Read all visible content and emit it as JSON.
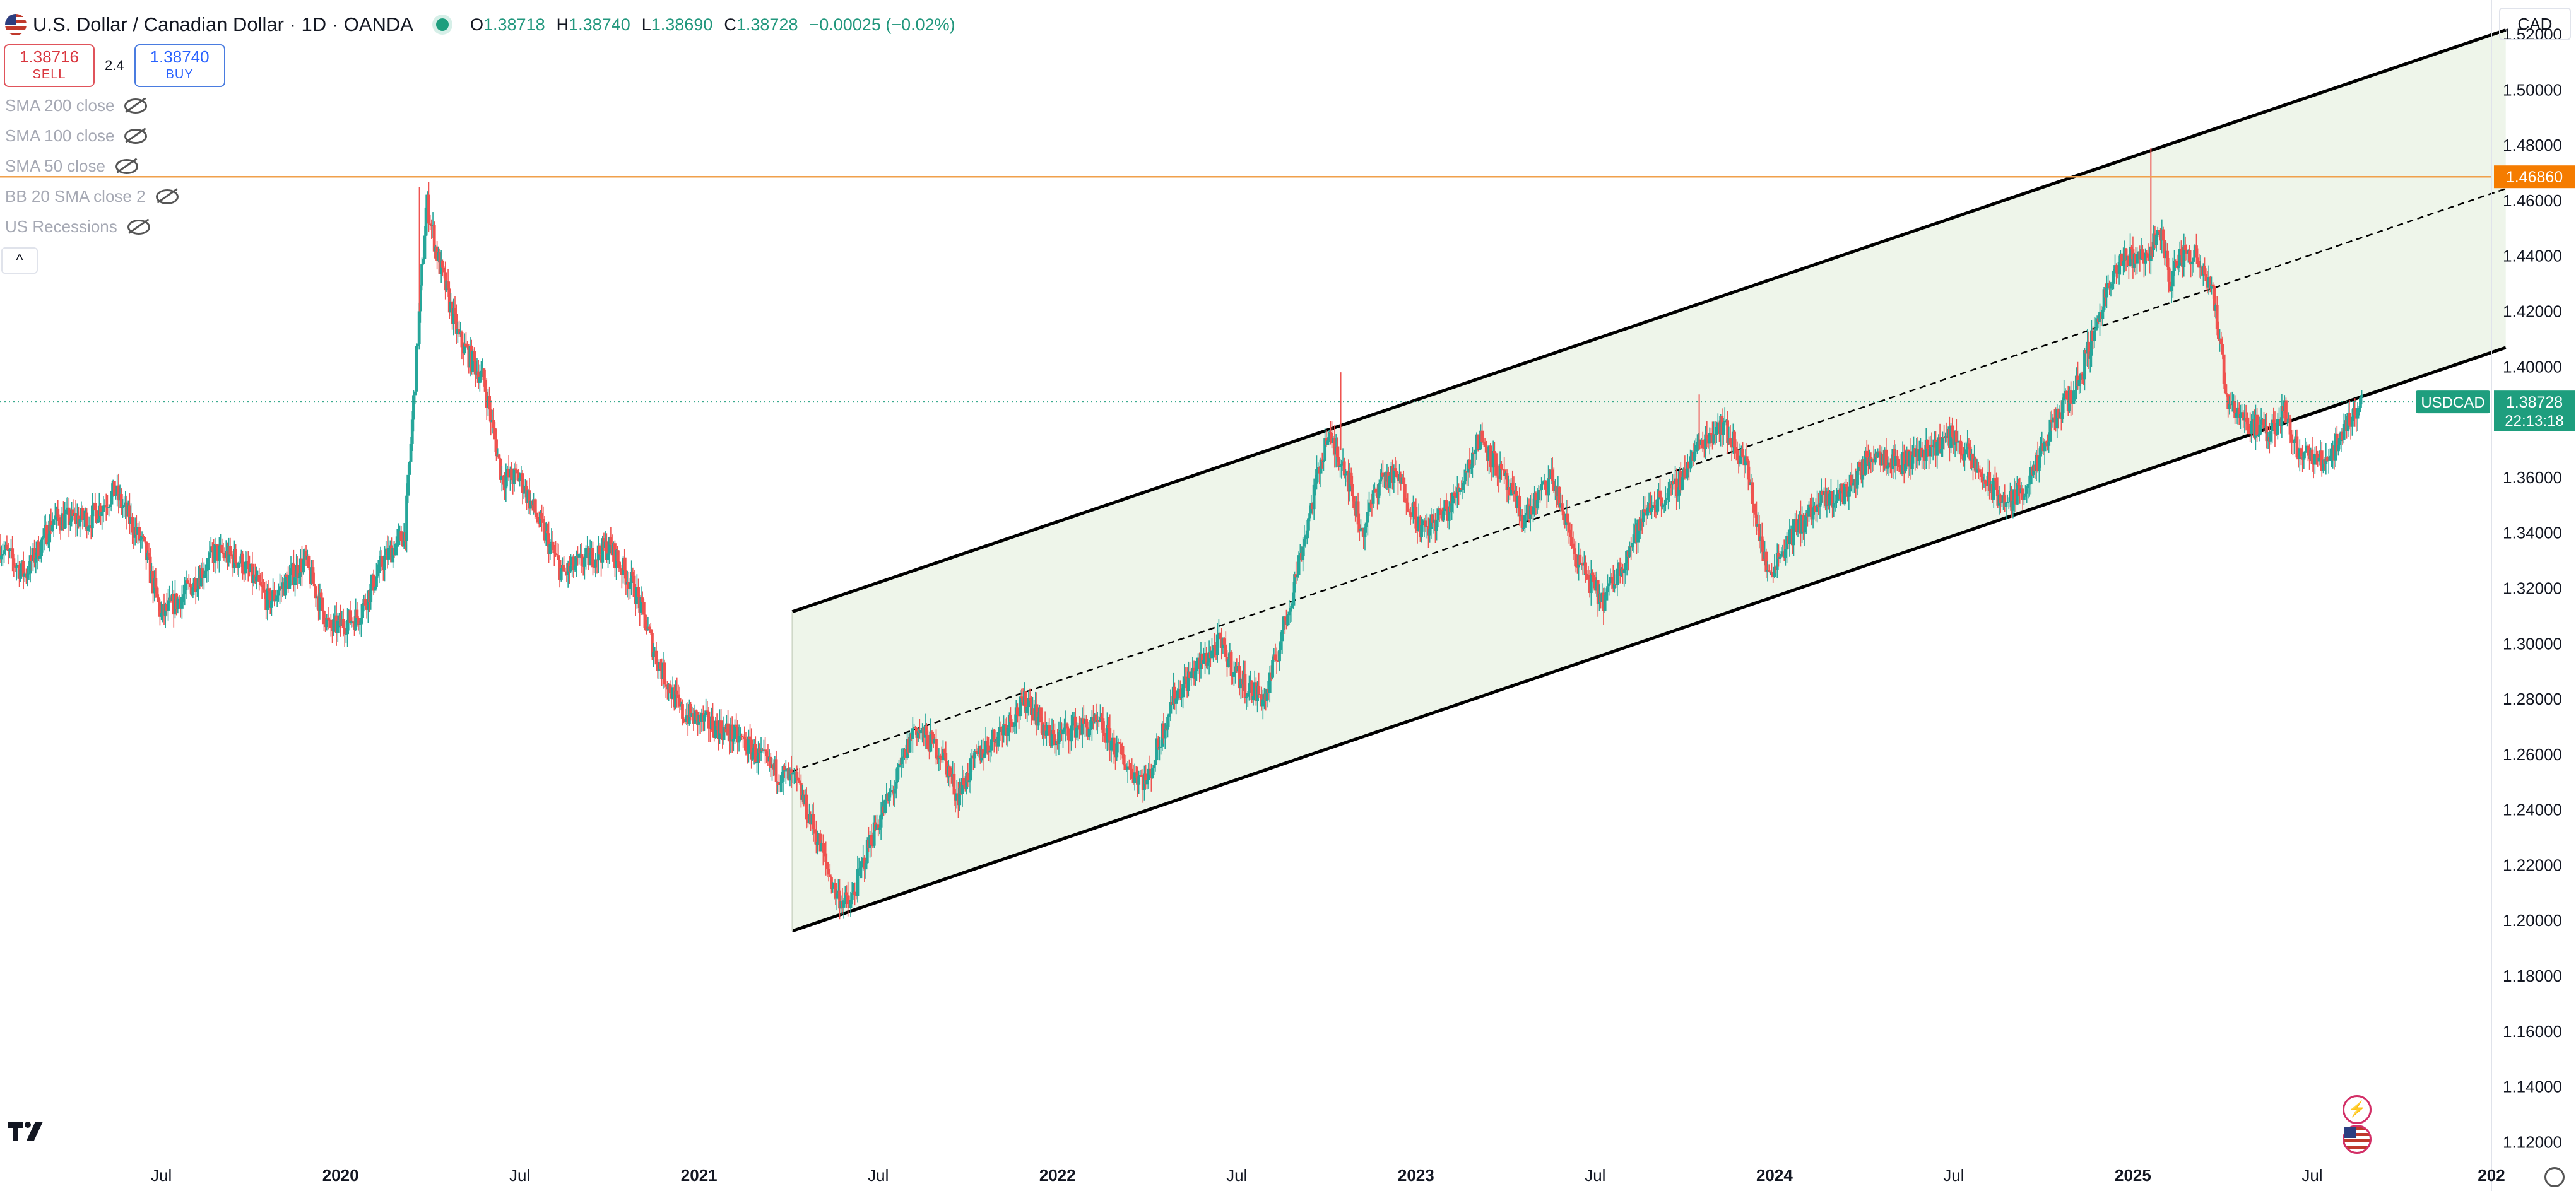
{
  "header": {
    "title": "U.S. Dollar / Canadian Dollar · 1D · OANDA",
    "o_label": "O",
    "o_value": "1.38718",
    "h_label": "H",
    "h_value": "1.38740",
    "l_label": "L",
    "l_value": "1.38690",
    "c_label": "C",
    "c_value": "1.38728",
    "change": "−0.00025 (−0.02%)"
  },
  "trade": {
    "sell_price": "1.38716",
    "sell_label": "SELL",
    "spread": "2.4",
    "buy_price": "1.38740",
    "buy_label": "BUY"
  },
  "indicators": [
    {
      "label": "SMA 200 close",
      "icon": "eye-off-icon"
    },
    {
      "label": "SMA 100 close",
      "icon": "eye-off-icon"
    },
    {
      "label": "SMA 50 close",
      "icon": "eye-off-icon"
    },
    {
      "label": "BB 20 SMA close 2",
      "icon": "eye-off-icon"
    },
    {
      "label": "US Recessions",
      "icon": "eye-off-icon"
    }
  ],
  "collapse_label": "^",
  "currency": "CAD",
  "colors": {
    "up": "#26a69a",
    "down": "#ef5350",
    "channel_fill": "#eef5ea",
    "hline": "#f0a04b",
    "price_tag": "#1e9e7e",
    "level_tag": "#f57c00"
  },
  "chart_data": {
    "type": "candlestick",
    "symbol": "USDCAD",
    "title": "U.S. Dollar / Canadian Dollar · 1D · OANDA",
    "y_ticks": [
      "1.12000",
      "1.14000",
      "1.16000",
      "1.18000",
      "1.20000",
      "1.22000",
      "1.24000",
      "1.26000",
      "1.28000",
      "1.30000",
      "1.32000",
      "1.34000",
      "1.36000",
      "1.38000",
      "1.40000",
      "1.42000",
      "1.44000",
      "1.46000",
      "1.48000",
      "1.50000",
      "1.52000"
    ],
    "ylim": [
      1.1128,
      1.5256
    ],
    "x_ticks": [
      "Jul",
      "2020",
      "Jul",
      "2021",
      "Jul",
      "2022",
      "Jul",
      "2023",
      "Jul",
      "2024",
      "Jul",
      "2025",
      "Jul",
      "202"
    ],
    "x_tick_years": [
      2019.5,
      2020.0,
      2020.5,
      2021.0,
      2021.5,
      2022.0,
      2022.5,
      2023.0,
      2023.5,
      2024.0,
      2024.5,
      2025.0,
      2025.5,
      2026.0
    ],
    "xlim": [
      2019.05,
      2026.0
    ],
    "price_path": [
      [
        2019.05,
        1.335
      ],
      [
        2019.12,
        1.325
      ],
      [
        2019.2,
        1.345
      ],
      [
        2019.3,
        1.345
      ],
      [
        2019.37,
        1.355
      ],
      [
        2019.45,
        1.335
      ],
      [
        2019.5,
        1.31
      ],
      [
        2019.58,
        1.32
      ],
      [
        2019.65,
        1.333
      ],
      [
        2019.72,
        1.33
      ],
      [
        2019.8,
        1.315
      ],
      [
        2019.9,
        1.33
      ],
      [
        2019.97,
        1.305
      ],
      [
        2020.05,
        1.31
      ],
      [
        2020.12,
        1.33
      ],
      [
        2020.18,
        1.34
      ],
      [
        2020.2,
        1.38
      ],
      [
        2020.22,
        1.42
      ],
      [
        2020.24,
        1.46
      ],
      [
        2020.27,
        1.44
      ],
      [
        2020.33,
        1.41
      ],
      [
        2020.4,
        1.395
      ],
      [
        2020.45,
        1.36
      ],
      [
        2020.5,
        1.36
      ],
      [
        2020.55,
        1.345
      ],
      [
        2020.62,
        1.325
      ],
      [
        2020.68,
        1.33
      ],
      [
        2020.75,
        1.335
      ],
      [
        2020.82,
        1.32
      ],
      [
        2020.88,
        1.295
      ],
      [
        2020.95,
        1.275
      ],
      [
        2021.05,
        1.27
      ],
      [
        2021.12,
        1.265
      ],
      [
        2021.2,
        1.255
      ],
      [
        2021.27,
        1.25
      ],
      [
        2021.33,
        1.23
      ],
      [
        2021.38,
        1.21
      ],
      [
        2021.42,
        1.205
      ],
      [
        2021.48,
        1.23
      ],
      [
        2021.55,
        1.25
      ],
      [
        2021.6,
        1.27
      ],
      [
        2021.68,
        1.26
      ],
      [
        2021.72,
        1.245
      ],
      [
        2021.78,
        1.26
      ],
      [
        2021.85,
        1.27
      ],
      [
        2021.92,
        1.28
      ],
      [
        2021.98,
        1.265
      ],
      [
        2022.05,
        1.27
      ],
      [
        2022.12,
        1.27
      ],
      [
        2022.2,
        1.255
      ],
      [
        2022.25,
        1.25
      ],
      [
        2022.32,
        1.28
      ],
      [
        2022.38,
        1.29
      ],
      [
        2022.45,
        1.3
      ],
      [
        2022.52,
        1.285
      ],
      [
        2022.58,
        1.28
      ],
      [
        2022.64,
        1.31
      ],
      [
        2022.7,
        1.345
      ],
      [
        2022.75,
        1.375
      ],
      [
        2022.8,
        1.365
      ],
      [
        2022.85,
        1.34
      ],
      [
        2022.9,
        1.36
      ],
      [
        2022.95,
        1.36
      ],
      [
        2023.02,
        1.34
      ],
      [
        2023.1,
        1.35
      ],
      [
        2023.18,
        1.375
      ],
      [
        2023.24,
        1.36
      ],
      [
        2023.3,
        1.345
      ],
      [
        2023.38,
        1.36
      ],
      [
        2023.45,
        1.33
      ],
      [
        2023.52,
        1.315
      ],
      [
        2023.58,
        1.33
      ],
      [
        2023.65,
        1.35
      ],
      [
        2023.72,
        1.355
      ],
      [
        2023.78,
        1.37
      ],
      [
        2023.85,
        1.38
      ],
      [
        2023.92,
        1.365
      ],
      [
        2023.98,
        1.325
      ],
      [
        2024.05,
        1.34
      ],
      [
        2024.12,
        1.35
      ],
      [
        2024.2,
        1.355
      ],
      [
        2024.28,
        1.37
      ],
      [
        2024.35,
        1.365
      ],
      [
        2024.42,
        1.37
      ],
      [
        2024.5,
        1.375
      ],
      [
        2024.58,
        1.36
      ],
      [
        2024.65,
        1.35
      ],
      [
        2024.72,
        1.36
      ],
      [
        2024.78,
        1.38
      ],
      [
        2024.85,
        1.395
      ],
      [
        2024.92,
        1.425
      ],
      [
        2024.98,
        1.44
      ],
      [
        2025.04,
        1.44
      ],
      [
        2025.08,
        1.45
      ],
      [
        2025.1,
        1.43
      ],
      [
        2025.13,
        1.44
      ],
      [
        2025.18,
        1.44
      ],
      [
        2025.22,
        1.43
      ],
      [
        2025.26,
        1.39
      ],
      [
        2025.32,
        1.38
      ],
      [
        2025.38,
        1.375
      ],
      [
        2025.42,
        1.385
      ],
      [
        2025.46,
        1.37
      ],
      [
        2025.52,
        1.365
      ],
      [
        2025.56,
        1.37
      ],
      [
        2025.6,
        1.38
      ],
      [
        2025.64,
        1.3873
      ]
    ],
    "channel": {
      "upper": [
        [
          2021.26,
          1.3115
        ],
        [
          2026.04,
          1.5216
        ]
      ],
      "lower": [
        [
          2021.26,
          1.1962
        ],
        [
          2026.04,
          1.4069
        ]
      ],
      "mid": [
        [
          2021.26,
          1.2539
        ],
        [
          2026.04,
          1.4643
        ]
      ]
    },
    "horizontal_line": {
      "value": 1.4686,
      "label": "1.46860"
    },
    "current_price": {
      "value": 1.38728,
      "label": "1.38728",
      "symbol": "USDCAD",
      "countdown": "22:13:18"
    }
  }
}
